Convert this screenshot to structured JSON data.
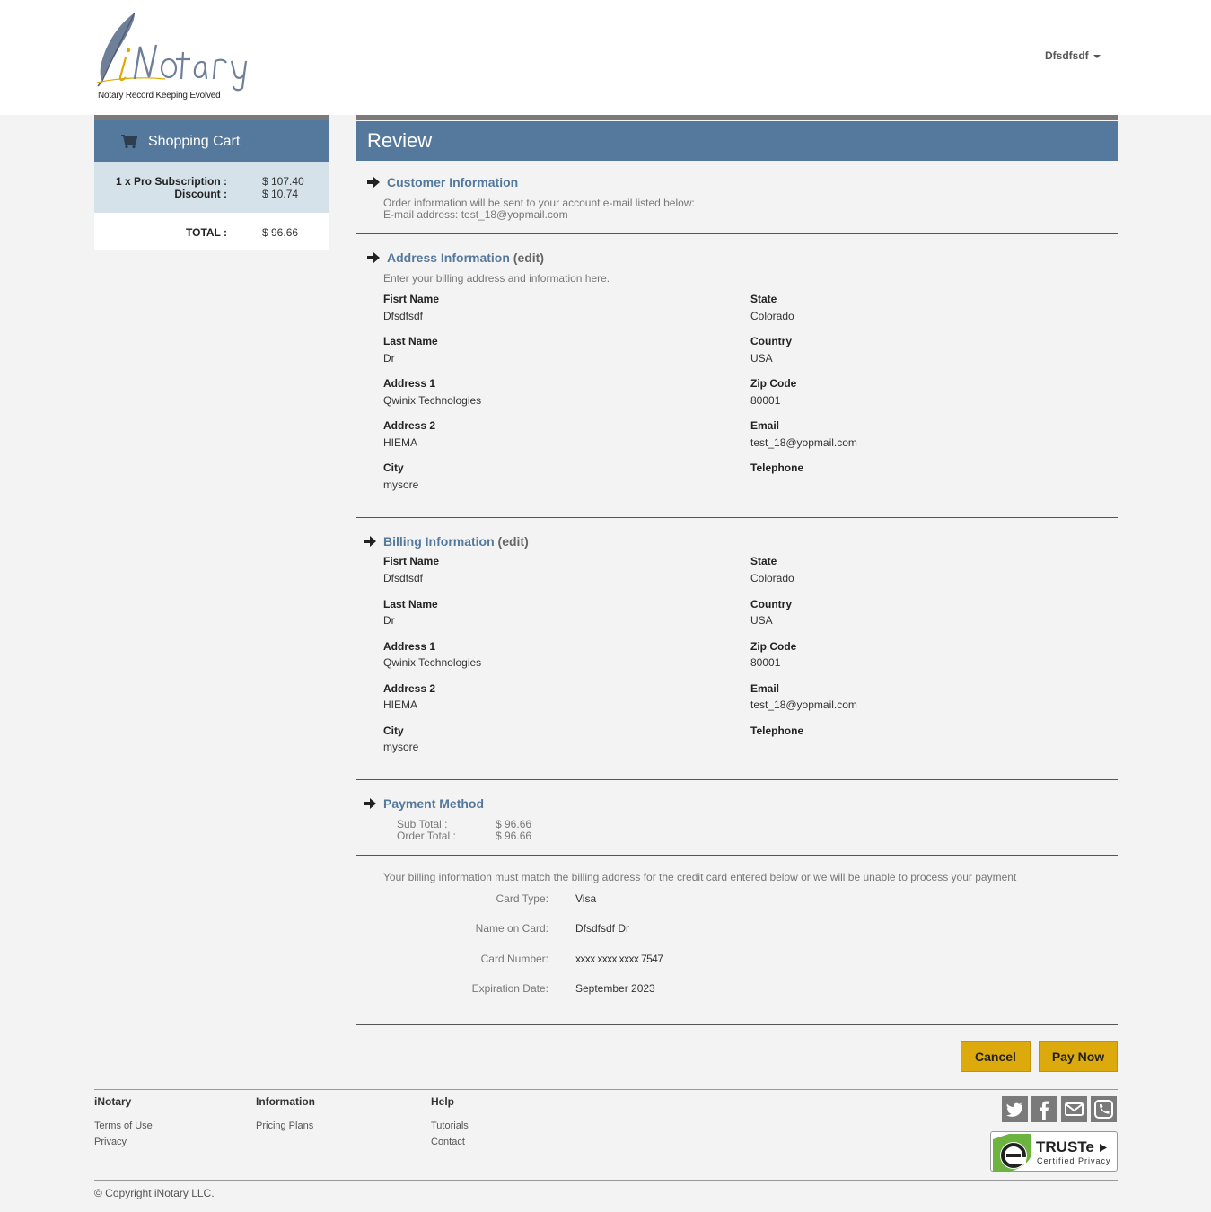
{
  "header": {
    "logo_tagline": "Notary Record Keeping Evolved",
    "user_menu": "Dfsdfsdf"
  },
  "cart": {
    "title": "Shopping Cart",
    "items": [
      {
        "label": "1 x Pro Subscription  :",
        "value": "$ 107.40"
      },
      {
        "label": "Discount  :",
        "value": "$ 10.74"
      }
    ],
    "total_label": "TOTAL  :",
    "total_value": "$ 96.66"
  },
  "review": {
    "title": "Review",
    "customer": {
      "title": "Customer Information",
      "line1": "Order information will be sent to your account e-mail listed below:",
      "line2": "E-mail address: test_18@yopmail.com"
    },
    "address": {
      "title": "Address Information",
      "edit": "(edit)",
      "intro": "Enter your billing address and information here.",
      "left": [
        {
          "label": "Fisrt Name",
          "value": "Dfsdfsdf"
        },
        {
          "label": "Last Name",
          "value": "Dr"
        },
        {
          "label": "Address 1",
          "value": "Qwinix Technologies"
        },
        {
          "label": "Address 2",
          "value": "HIEMA"
        },
        {
          "label": "City",
          "value": "mysore"
        }
      ],
      "right": [
        {
          "label": "State",
          "value": "Colorado"
        },
        {
          "label": "Country",
          "value": "USA"
        },
        {
          "label": "Zip Code",
          "value": "80001"
        },
        {
          "label": "Email",
          "value": "test_18@yopmail.com"
        },
        {
          "label": "Telephone",
          "value": ""
        }
      ]
    },
    "billing": {
      "title": "Billing Information",
      "edit": "(edit)",
      "left": [
        {
          "label": "Fisrt Name",
          "value": "Dfsdfsdf"
        },
        {
          "label": "Last Name",
          "value": "Dr"
        },
        {
          "label": "Address 1",
          "value": "Qwinix Technologies"
        },
        {
          "label": "Address 2",
          "value": "HIEMA"
        },
        {
          "label": "City",
          "value": "mysore"
        }
      ],
      "right": [
        {
          "label": "State",
          "value": "Colorado"
        },
        {
          "label": "Country",
          "value": "USA"
        },
        {
          "label": "Zip Code",
          "value": "80001"
        },
        {
          "label": "Email",
          "value": "test_18@yopmail.com"
        },
        {
          "label": "Telephone",
          "value": ""
        }
      ]
    },
    "payment": {
      "title": "Payment Method",
      "subtotal_label": "Sub Total :",
      "subtotal_value": "$ 96.66",
      "ordertotal_label": "Order Total :",
      "ordertotal_value": "$ 96.66"
    },
    "card": {
      "notice": "Your billing information must match the billing address for the credit card entered below or we will be unable to process your payment",
      "rows": [
        {
          "label": "Card Type:",
          "value": "Visa"
        },
        {
          "label": "Name on Card:",
          "value": "Dfsdfsdf Dr"
        },
        {
          "label": "Card Number:",
          "value": "xxxx xxxx xxxx 7547"
        },
        {
          "label": "Expiration Date:",
          "value": "September 2023"
        }
      ]
    },
    "buttons": {
      "cancel": "Cancel",
      "pay": "Pay Now"
    }
  },
  "footer": {
    "columns": [
      {
        "title": "iNotary",
        "links": [
          "Terms of Use",
          "Privacy"
        ]
      },
      {
        "title": "Information",
        "links": [
          "Pricing Plans"
        ]
      },
      {
        "title": "Help",
        "links": [
          "Tutorials",
          "Contact"
        ]
      }
    ],
    "social": [
      "twitter-icon",
      "facebook-icon",
      "email-icon",
      "phone-icon"
    ],
    "truste_title": "TRUSTe",
    "truste_sub": "Certified Privacy",
    "copyright": "© Copyright iNotary LLC."
  },
  "colors": {
    "accent": "#55799c",
    "button": "#dcaa0c",
    "cart_bg": "#d6e2ea",
    "logo_gold": "#e0a800"
  }
}
